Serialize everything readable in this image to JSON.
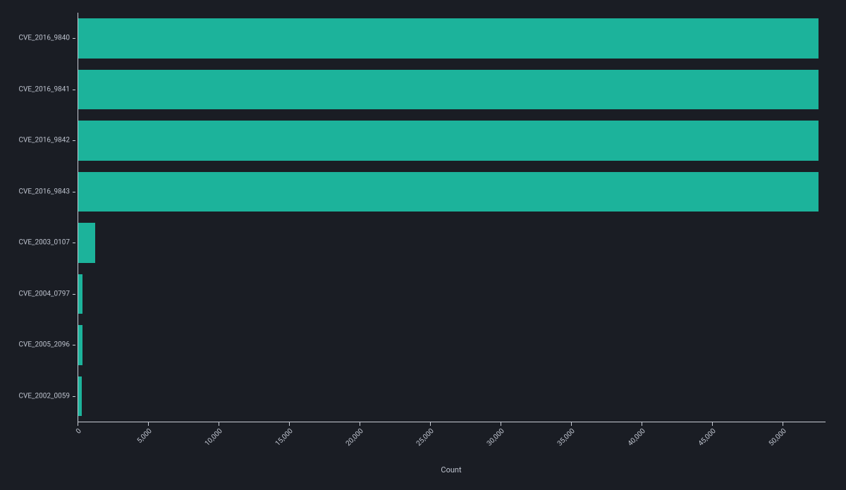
{
  "chart_data": {
    "type": "bar",
    "orientation": "horizontal",
    "categories": [
      "CVE_2016_9840",
      "CVE_2016_9841",
      "CVE_2016_9842",
      "CVE_2016_9843",
      "CVE_2003_0107",
      "CVE_2004_0797",
      "CVE_2005_2096",
      "CVE_2002_0059"
    ],
    "values": [
      52500,
      52500,
      52500,
      52500,
      1200,
      280,
      300,
      260
    ],
    "xlabel": "Count",
    "ylabel": "",
    "xlim": [
      0,
      53000
    ],
    "x_ticks": [
      0,
      5000,
      10000,
      15000,
      20000,
      25000,
      30000,
      35000,
      40000,
      45000,
      50000
    ],
    "x_tick_labels": [
      "0",
      "5,000",
      "10,000",
      "15,000",
      "20,000",
      "25,000",
      "30,000",
      "35,000",
      "40,000",
      "45,000",
      "50,000"
    ],
    "bar_color": "#1cb39b",
    "background": "#1a1d24"
  }
}
